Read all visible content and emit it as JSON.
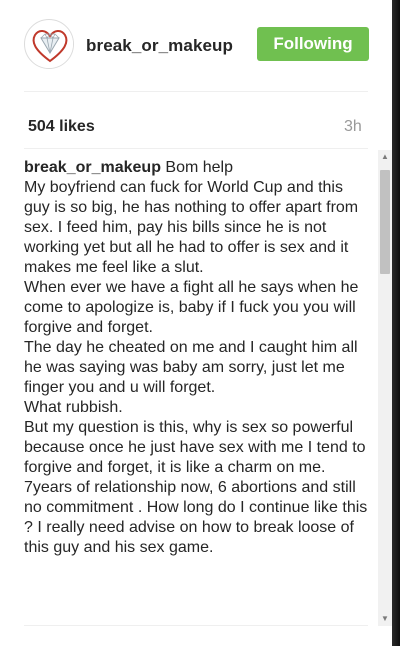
{
  "header": {
    "username": "break_or_makeup",
    "follow_label": "Following"
  },
  "post": {
    "likes": "504 likes",
    "time": "3h"
  },
  "caption": {
    "username": "break_or_makeup",
    "text": " Bom help\nMy boyfriend can fuck for World Cup and this guy is so big, he has nothing to offer apart from sex. I feed him, pay his bills since he is not working yet but all he had to offer is sex and it makes me feel like a slut.\nWhen ever we have a fight all he says when he come to apologize is, baby if I fuck you you will forgive and forget.\nThe day he cheated on me and I caught him all he was saying was baby am sorry, just let me finger you and u will forget.\nWhat rubbish.\nBut my question is this, why is sex so powerful because once he just have sex with me I tend to forgive and forget, it is like a charm on me.\n7years of relationship now, 6 abortions and still no commitment . How long do I continue like this ? I really need advise on how to break loose of this guy and his sex game."
  },
  "colors": {
    "follow_button": "#70c050",
    "time_text": "#999999"
  },
  "icons": {
    "avatar": "heart-diamond-logo",
    "scroll_up": "scroll-up-arrow",
    "scroll_down": "scroll-down-arrow"
  }
}
